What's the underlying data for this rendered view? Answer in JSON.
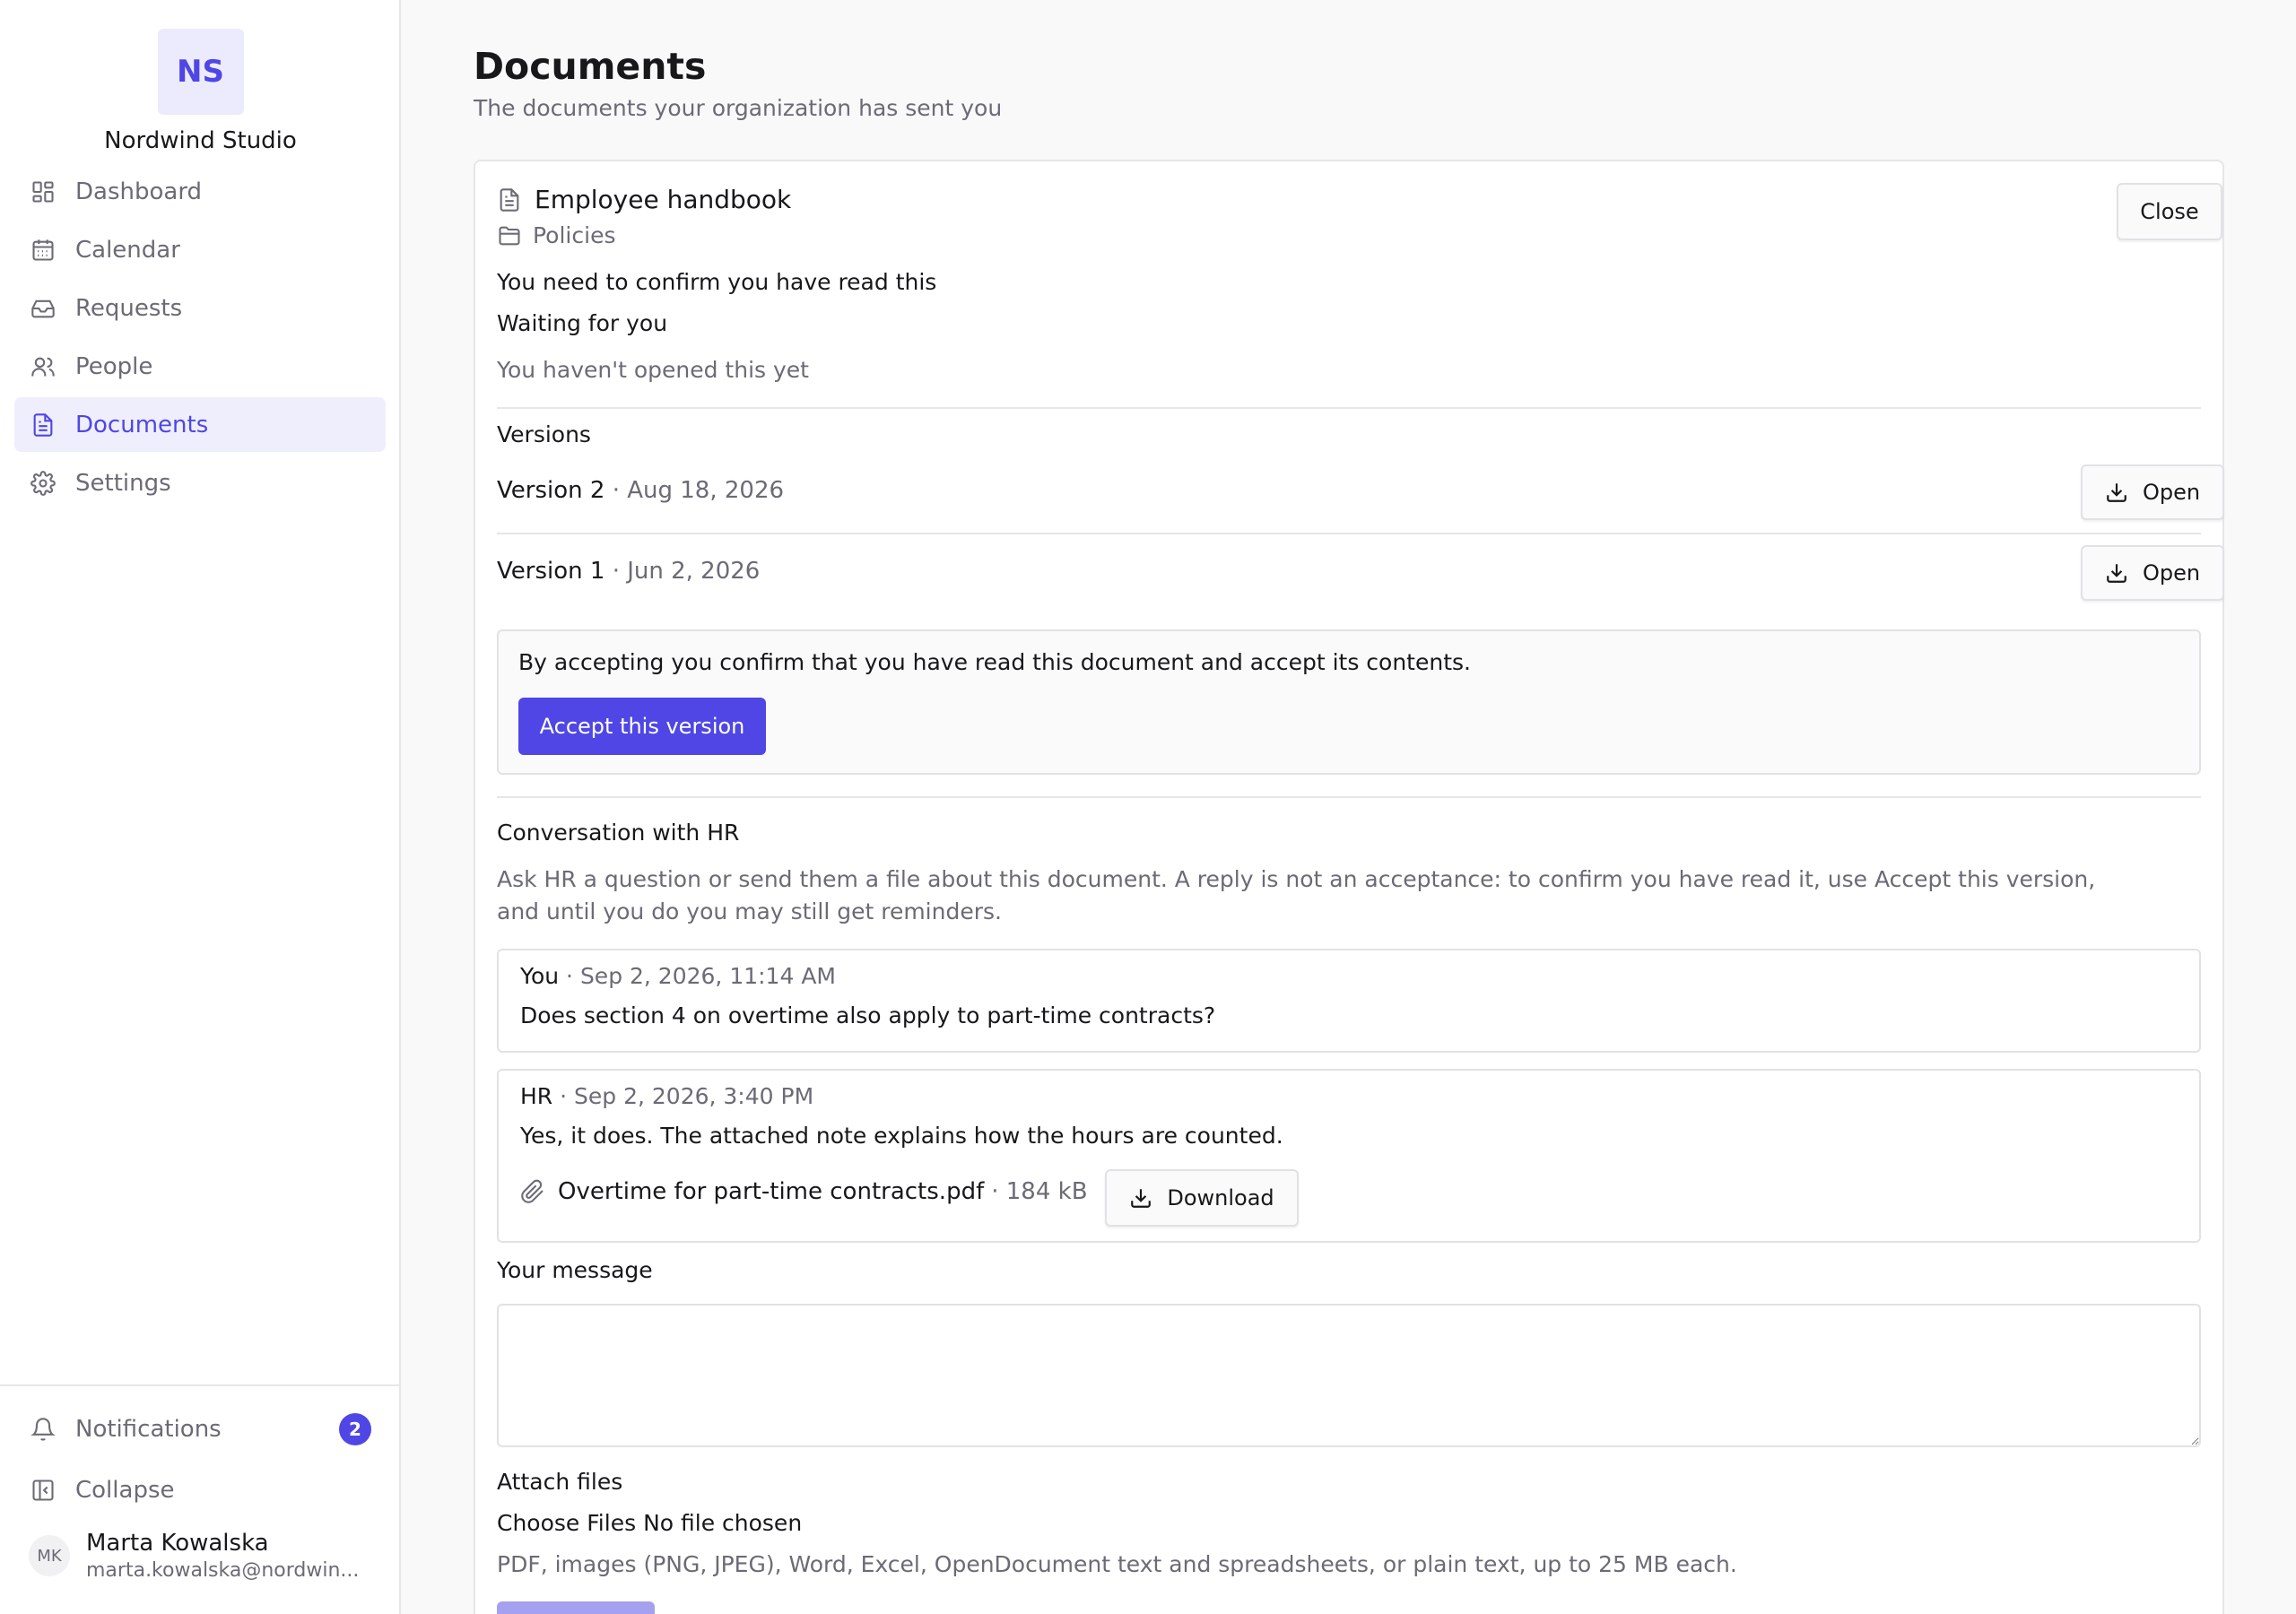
{
  "brand": {
    "initials": "NS",
    "name": "Nordwind Studio"
  },
  "nav": {
    "items": [
      {
        "label": "Dashboard",
        "icon": "grid-icon"
      },
      {
        "label": "Calendar",
        "icon": "calendar-icon"
      },
      {
        "label": "Requests",
        "icon": "inbox-icon"
      },
      {
        "label": "People",
        "icon": "users-icon"
      },
      {
        "label": "Documents",
        "icon": "document-icon",
        "active": true
      },
      {
        "label": "Settings",
        "icon": "gear-icon"
      }
    ]
  },
  "sidebar_bottom": {
    "notifications_label": "Notifications",
    "notifications_count": "2",
    "collapse_label": "Collapse"
  },
  "user": {
    "initials": "MK",
    "name": "Marta Kowalska",
    "email": "marta.kowalska@nordwin..."
  },
  "page": {
    "title": "Documents",
    "subtitle": "The documents your organization has sent you"
  },
  "document": {
    "title": "Employee handbook",
    "folder": "Policies",
    "close_label": "Close",
    "requirement": "You need to confirm you have read this",
    "status": "Waiting for you",
    "opened_status": "You haven't opened this yet",
    "versions_heading": "Versions",
    "versions": [
      {
        "label": "Version 2",
        "date": "· Aug 18, 2026",
        "open_label": "Open"
      },
      {
        "label": "Version 1",
        "date": "· Jun 2, 2026",
        "open_label": "Open"
      }
    ],
    "accept_text": "By accepting you confirm that you have read this document and accept its contents.",
    "accept_button": "Accept this version"
  },
  "conversation": {
    "heading": "Conversation with HR",
    "help_line1": "Ask HR a question or send them a file about this document. A reply is not an acceptance: to confirm you have read it, use Accept this version,",
    "help_line2": "and until you do you may still get reminders.",
    "messages": [
      {
        "author": "You",
        "time": "· Sep 2, 2026, 11:14 AM",
        "text": "Does section 4 on overtime also apply to part-time contracts?"
      },
      {
        "author": "HR",
        "time": "· Sep 2, 2026, 3:40 PM",
        "text": "Yes, it does. The attached note explains how the hours are counted.",
        "attachment": {
          "name": "Overtime for part-time contracts.pdf",
          "size": "· 184 kB",
          "download_label": "Download"
        }
      }
    ],
    "message_label": "Your message",
    "attach_label": "Attach files",
    "file_button": "Choose Files",
    "file_status": "No file chosen",
    "file_help": "PDF, images (PNG, JPEG), Word, Excel, OpenDocument text and spreadsheets, or plain text, up to 25 MB each."
  },
  "colors": {
    "accent": "#4f46e5",
    "accent_soft": "#efeefd"
  }
}
